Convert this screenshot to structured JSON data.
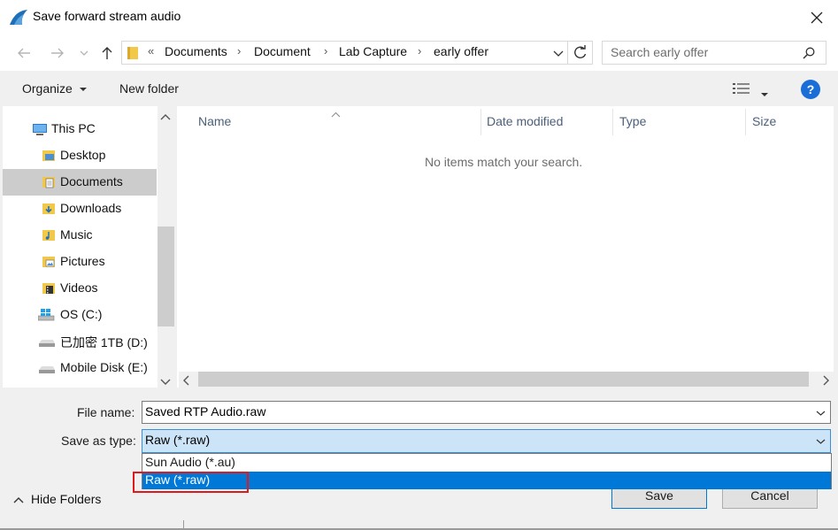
{
  "window": {
    "title": "Save forward stream audio"
  },
  "nav": {
    "back_icon": "arrow-left-icon",
    "forward_icon": "arrow-right-icon",
    "recent_icon": "chevron-down-icon",
    "up_icon": "arrow-up-icon",
    "overflow": "«",
    "breadcrumbs": [
      "Documents",
      "Document",
      "Lab Capture",
      "early offer"
    ],
    "search_placeholder": "Search early offer"
  },
  "toolbar": {
    "organize_label": "Organize",
    "new_folder_label": "New folder"
  },
  "sidebar": {
    "items": [
      {
        "label": "This PC",
        "icon": "pc-icon"
      },
      {
        "label": "Desktop",
        "icon": "folder-icon"
      },
      {
        "label": "Documents",
        "icon": "document-folder-icon"
      },
      {
        "label": "Downloads",
        "icon": "downloads-folder-icon"
      },
      {
        "label": "Music",
        "icon": "music-folder-icon"
      },
      {
        "label": "Pictures",
        "icon": "pictures-folder-icon"
      },
      {
        "label": "Videos",
        "icon": "videos-folder-icon"
      },
      {
        "label": "OS (C:)",
        "icon": "windows-drive-icon"
      },
      {
        "label": "已加密 1TB (D:)",
        "icon": "drive-icon"
      },
      {
        "label": "Mobile Disk (E:)",
        "icon": "drive-icon"
      }
    ],
    "selected": "Documents"
  },
  "filelist": {
    "columns": [
      "Name",
      "Date modified",
      "Type",
      "Size"
    ],
    "empty_message": "No items match your search."
  },
  "form": {
    "file_name_label": "File name:",
    "file_name_value": "Saved RTP Audio.raw",
    "save_as_type_label": "Save as type:",
    "save_as_type_value": "Raw (*.raw)",
    "type_options": [
      "Sun Audio (*.au)",
      "Raw (*.raw)"
    ],
    "highlighted_option": "Raw (*.raw)"
  },
  "footer": {
    "hide_folders_label": "Hide Folders",
    "save_label": "Save",
    "cancel_label": "Cancel"
  },
  "colors": {
    "accent": "#0078d7",
    "selection_bg": "#cce4f7",
    "highlight_box": "#e0191d",
    "help_icon": "#1a6ed8"
  }
}
